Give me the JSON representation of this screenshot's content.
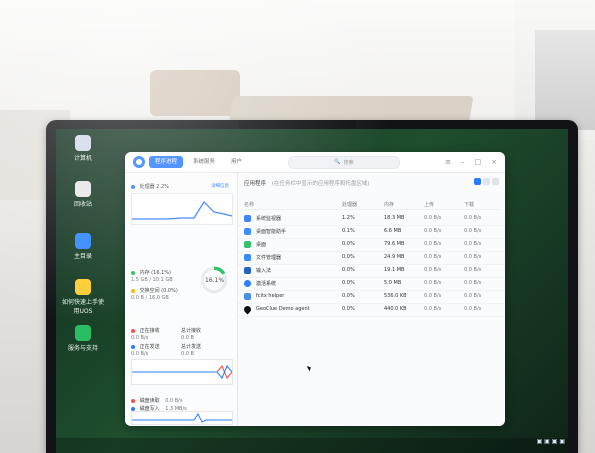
{
  "desktop": {
    "icons": [
      {
        "label": "计算机",
        "icon": "computer-icon",
        "color": "#cfd9ea"
      },
      {
        "label": "回收站",
        "icon": "trash-icon",
        "color": "#e6e6e6"
      },
      {
        "label": "主目录",
        "icon": "folder-icon",
        "color": "#2f86ff"
      },
      {
        "label": "如何快速上手使用UOS",
        "icon": "help-icon",
        "color": "#ffcc33"
      },
      {
        "label": "服务与支持",
        "icon": "support-icon",
        "color": "#2bbd64"
      }
    ]
  },
  "window": {
    "tabs": [
      {
        "label": "程序进程",
        "active": true
      },
      {
        "label": "系统服务",
        "active": false
      },
      {
        "label": "用户",
        "active": false
      }
    ],
    "search_placeholder": "搜索",
    "left": {
      "cpu_label": "处理器 2.2%",
      "cpu_details_link": "详细信息",
      "mem_label": "内存 (16.1%)",
      "mem_detail": "1.5 GB / 10.1 GB",
      "swap_label": "交换空间 (0.0%)",
      "swap_detail": "0.0 B / 16.0 GB",
      "ring_text": "16.1%",
      "net": [
        {
          "label": "正在接收",
          "value": "0.0 B/s",
          "total_label": "总计接收",
          "total": "0.0 B"
        },
        {
          "label": "正在发送",
          "value": "0.0 B/s",
          "total_label": "总计发送",
          "total": "0.0 B"
        }
      ],
      "disk": [
        {
          "label": "磁盘读取",
          "value": "0.0 B/s"
        },
        {
          "label": "磁盘写入",
          "value": "1.3 MB/s"
        }
      ]
    },
    "right": {
      "title": "应用程序",
      "note": "(在任务栏中显示的应用程序和托盘区域)",
      "columns": {
        "name": "名称",
        "cpu": "处理器",
        "mem": "内存",
        "up": "上传",
        "down": "下载"
      },
      "rows": [
        {
          "name": "系统监视器",
          "cpu": "1.2%",
          "mem": "18.3 MB",
          "up": "0.0 B/s",
          "down": "0.0 B/s",
          "icon": "monitor-icon",
          "color": "#2b7cff"
        },
        {
          "name": "桌面智能助手",
          "cpu": "0.1%",
          "mem": "6.6 MB",
          "up": "0.0 B/s",
          "down": "0.0 B/s",
          "icon": "assistant-icon",
          "color": "#2f86ff"
        },
        {
          "name": "桌面",
          "cpu": "0.0%",
          "mem": "79.6 MB",
          "up": "0.0 B/s",
          "down": "0.0 B/s",
          "icon": "desktop-icon",
          "color": "#2bbd64"
        },
        {
          "name": "文件管理器",
          "cpu": "0.0%",
          "mem": "24.9 MB",
          "up": "0.0 B/s",
          "down": "0.0 B/s",
          "icon": "files-icon",
          "color": "#2f86ff"
        },
        {
          "name": "输入法",
          "cpu": "0.0%",
          "mem": "19.1 MB",
          "up": "0.0 B/s",
          "down": "0.0 B/s",
          "icon": "input-method-icon",
          "color": "#1f5fbf"
        },
        {
          "name": "激活系统",
          "cpu": "0.0%",
          "mem": "5.0 MB",
          "up": "0.0 B/s",
          "down": "0.0 B/s",
          "icon": "activation-icon",
          "color": "#2b7cff"
        },
        {
          "name": "fcitx helper",
          "cpu": "0.0%",
          "mem": "536.0 KB",
          "up": "0.0 B/s",
          "down": "0.0 B/s",
          "icon": "keyboard-icon",
          "color": "#4a90e2"
        },
        {
          "name": "GeoClue Demo agent",
          "cpu": "0.0%",
          "mem": "440.0 KB",
          "up": "0.0 B/s",
          "down": "0.0 B/s",
          "icon": "location-pin-icon",
          "color": "#111111"
        }
      ]
    }
  }
}
